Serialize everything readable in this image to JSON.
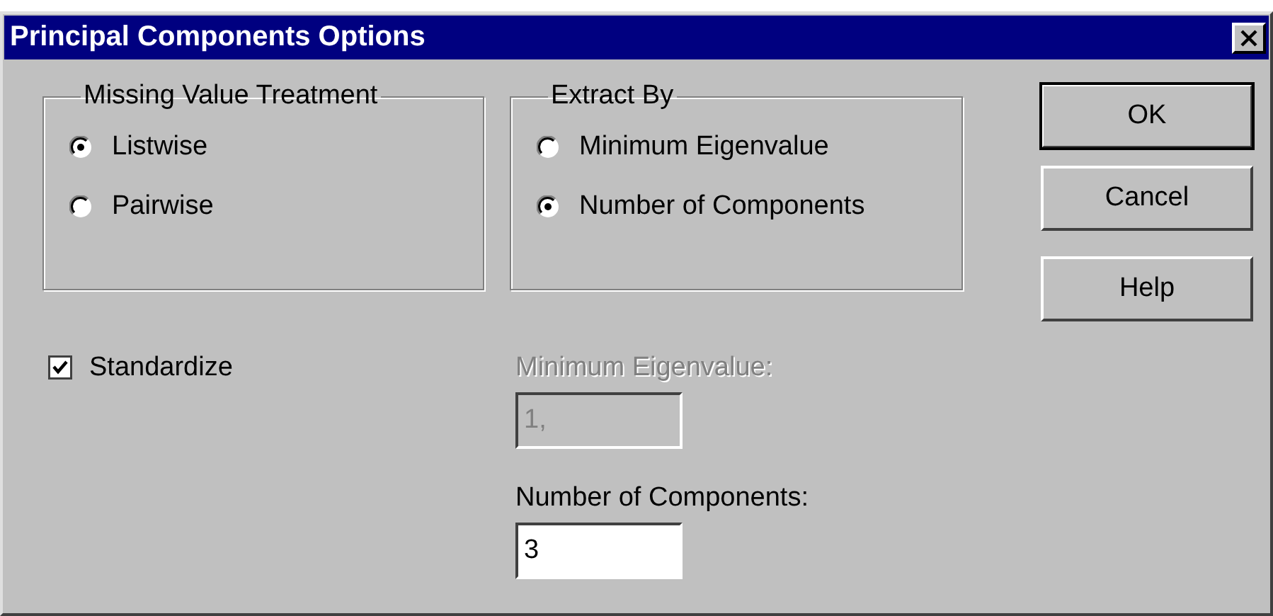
{
  "window": {
    "title": "Principal Components Options"
  },
  "groups": [
    {
      "title": "Missing Value Treatment",
      "options": [
        {
          "label": "Listwise",
          "selected": true
        },
        {
          "label": "Pairwise",
          "selected": false
        }
      ]
    },
    {
      "title": "Extract By",
      "options": [
        {
          "label": "Minimum Eigenvalue",
          "selected": false
        },
        {
          "label": "Number of Components",
          "selected": true
        }
      ]
    }
  ],
  "checkbox": {
    "label": "Standardize",
    "checked": true
  },
  "fields": [
    {
      "label": "Minimum Eigenvalue:",
      "value": "1,",
      "disabled": true
    },
    {
      "label": "Number of Components:",
      "value": "3",
      "disabled": false
    }
  ],
  "buttons": [
    {
      "label": "OK",
      "default": true
    },
    {
      "label": "Cancel",
      "default": false
    },
    {
      "label": "Help",
      "default": false
    }
  ]
}
